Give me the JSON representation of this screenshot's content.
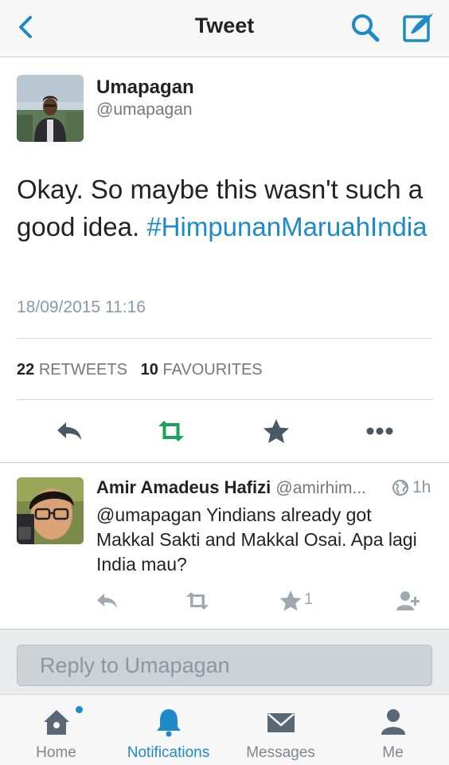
{
  "nav": {
    "title": "Tweet"
  },
  "tweet": {
    "author_name": "Umapagan",
    "author_handle": "@umapagan",
    "text": "Okay. So maybe this wasn't such a good idea.",
    "hashtag": "#HimpunanMaruahIndia",
    "timestamp": "18/09/2015 11:16",
    "retweet_count": "22",
    "retweet_label": "RETWEETS",
    "favourite_count": "10",
    "favourite_label": "FAVOURITES"
  },
  "reply": {
    "author_name": "Amir Amadeus Hafizi",
    "author_handle": "@amirhim...",
    "time": "1h",
    "text": "@umapagan Yindians already got Makkal Sakti and Makkal Osai. Apa lagi India mau?",
    "favourite_count": "1"
  },
  "compose": {
    "placeholder": "Reply to Umapagan"
  },
  "tabs": [
    {
      "label": "Home",
      "icon": "home-icon"
    },
    {
      "label": "Notifications",
      "icon": "bell-icon"
    },
    {
      "label": "Messages",
      "icon": "envelope-icon"
    },
    {
      "label": "Me",
      "icon": "person-icon"
    }
  ],
  "colors": {
    "accent": "#1d8ac9",
    "retweet_green": "#19a35a",
    "icon_gray": "#8899a6"
  }
}
